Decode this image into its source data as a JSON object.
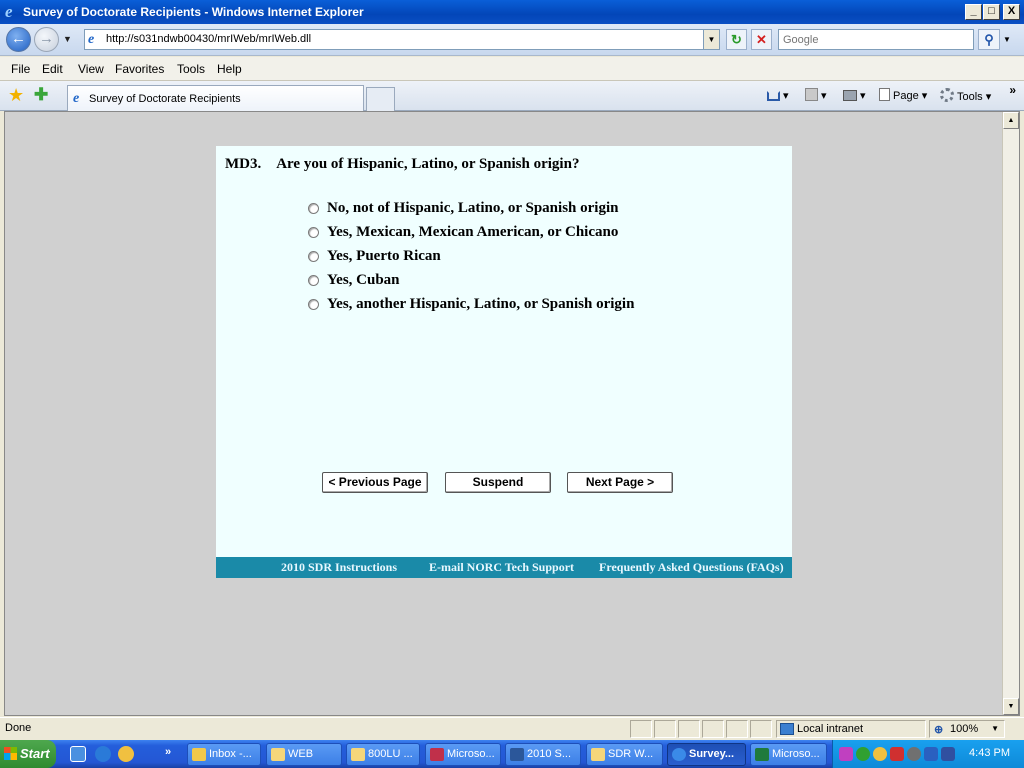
{
  "window": {
    "title": "Survey of Doctorate Recipients - Windows Internet Explorer",
    "controls": [
      "_",
      "□",
      "X"
    ]
  },
  "address_bar": {
    "url": "http://s031ndwb00430/mrIWeb/mrIWeb.dll",
    "search_placeholder": "Google"
  },
  "menu": [
    "File",
    "Edit",
    "View",
    "Favorites",
    "Tools",
    "Help"
  ],
  "tab": {
    "title": "Survey of Doctorate Recipients"
  },
  "commands": {
    "page": "Page",
    "tools": "Tools"
  },
  "survey": {
    "question_number": "MD3.",
    "question_text": "Are you of Hispanic, Latino, or Spanish origin?",
    "options": [
      "No, not of Hispanic, Latino, or Spanish origin",
      "Yes, Mexican, Mexican American, or Chicano",
      "Yes, Puerto Rican",
      "Yes, Cuban",
      "Yes, another Hispanic, Latino, or Spanish origin"
    ],
    "buttons": {
      "previous": "< Previous Page",
      "suspend": "Suspend",
      "next": "Next Page >"
    },
    "footer_links": [
      "2010 SDR Instructions",
      "E-mail NORC Tech Support",
      "Frequently Asked Questions (FAQs)"
    ]
  },
  "status_bar": {
    "status": "Done",
    "zone": "Local intranet",
    "zoom": "100%"
  },
  "taskbar": {
    "start_label": "Start",
    "tasks": [
      "Inbox -...",
      "WEB",
      "800LU ...",
      "Microso...",
      "2010 S...",
      "SDR W...",
      "Survey...",
      "Microso..."
    ],
    "clock": "4:43 PM"
  },
  "colors": {
    "survey_background": "#f0ffff",
    "footer_bar": "#1a8aa8",
    "viewport_background": "#d0d0d0",
    "titlebar": "#0346b8"
  }
}
